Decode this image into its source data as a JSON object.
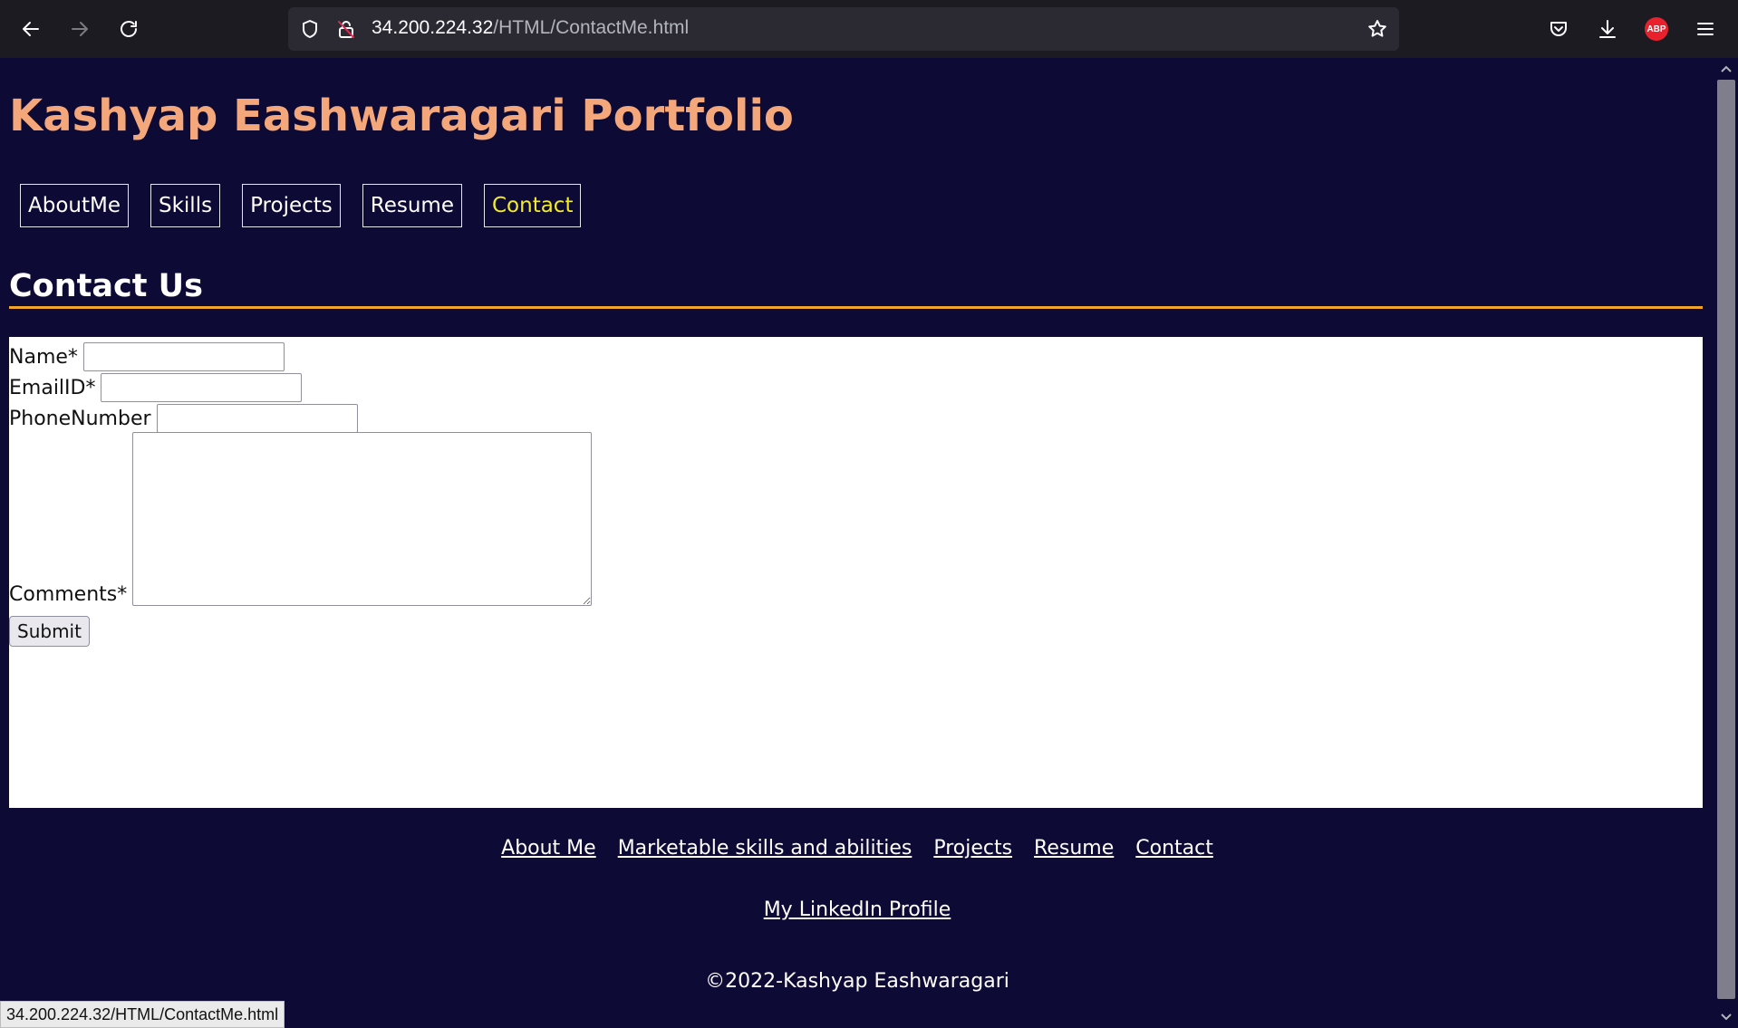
{
  "browser": {
    "url_host": "34.200.224.32",
    "url_path": "/HTML/ContactMe.html",
    "status_text": "34.200.224.32/HTML/ContactMe.html",
    "abp_label": "ABP",
    "icons": [
      "back-icon",
      "forward-icon",
      "reload-icon",
      "shield-icon",
      "lock-icon",
      "star-icon",
      "pocket-icon",
      "download-icon",
      "adblock-icon",
      "menu-icon"
    ]
  },
  "page": {
    "site_title": "Kashyap Eashwaragari Portfolio",
    "nav": [
      {
        "label": "AboutMe"
      },
      {
        "label": "Skills"
      },
      {
        "label": "Projects"
      },
      {
        "label": "Resume"
      },
      {
        "label": "Contact"
      }
    ],
    "active_nav": "Contact",
    "section_title": "Contact Us",
    "form": {
      "name_label": "Name*",
      "name_value": "",
      "email_label": "EmailID*",
      "email_value": "",
      "phone_label": "PhoneNumber",
      "phone_value": "",
      "comments_label": "Comments*",
      "comments_value": "",
      "submit_label": "Submit"
    },
    "footer": {
      "links": [
        {
          "label": "About Me"
        },
        {
          "label": "Marketable skills and abilities"
        },
        {
          "label": "Projects"
        },
        {
          "label": "Resume"
        },
        {
          "label": "Contact"
        }
      ],
      "linkedin_label": "My LinkedIn Profile",
      "copyright": "©2022-Kashyap Eashwaragari"
    }
  },
  "colors": {
    "page_bg": "#0d0a35",
    "title": "#f4a77a",
    "active_nav": "#f2ec2a",
    "rule": "#f0a52a"
  }
}
